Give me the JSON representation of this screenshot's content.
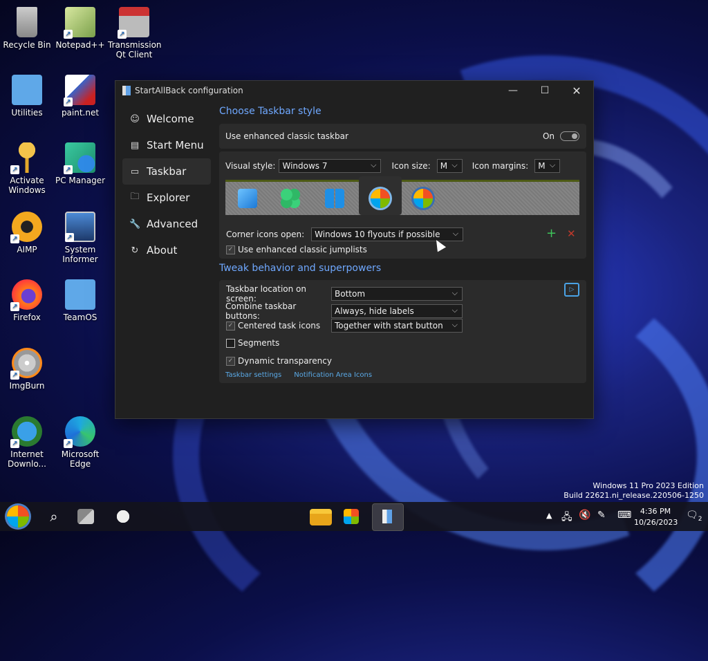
{
  "desktop_icons": [
    {
      "label": "Recycle Bin"
    },
    {
      "label": "Notepad++"
    },
    {
      "label": "Transmission Qt Client"
    },
    {
      "label": "Utilities"
    },
    {
      "label": "paint.net"
    },
    {
      "label": "Activate Windows"
    },
    {
      "label": "PC Manager"
    },
    {
      "label": "AIMP"
    },
    {
      "label": "System Informer"
    },
    {
      "label": "Firefox"
    },
    {
      "label": "TeamOS"
    },
    {
      "label": "ImgBurn"
    },
    {
      "label": "Internet Downlo..."
    },
    {
      "label": "Microsoft Edge"
    }
  ],
  "window": {
    "title": "StartAllBack configuration",
    "nav": [
      {
        "label": "Welcome",
        "icon": "smiley-icon"
      },
      {
        "label": "Start Menu",
        "icon": "start-menu-icon"
      },
      {
        "label": "Taskbar",
        "icon": "taskbar-icon"
      },
      {
        "label": "Explorer",
        "icon": "folder-icon"
      },
      {
        "label": "Advanced",
        "icon": "wrench-icon"
      },
      {
        "label": "About",
        "icon": "about-icon"
      }
    ],
    "taskbar_style": {
      "heading": "Choose Taskbar style",
      "enhanced_label": "Use enhanced classic taskbar",
      "enhanced_state": "On",
      "visual_style_label": "Visual style:",
      "visual_style_value": "Windows 7",
      "icon_size_label": "Icon size:",
      "icon_size_value": "M",
      "icon_margins_label": "Icon margins:",
      "icon_margins_value": "M",
      "corner_icons_label": "Corner icons open:",
      "corner_icons_value": "Windows 10 flyouts if possible",
      "jumplists_label": "Use enhanced classic jumplists"
    },
    "tweak": {
      "heading": "Tweak behavior and superpowers",
      "location_label": "Taskbar location on screen:",
      "location_value": "Bottom",
      "combine_label": "Combine taskbar buttons:",
      "combine_value": "Always, hide labels",
      "centered_label": "Centered task icons",
      "centered_value": "Together with start button",
      "segments_label": "Segments",
      "transparency_label": "Dynamic transparency",
      "link_taskbar_settings": "Taskbar settings",
      "link_notification_icons": "Notification Area Icons"
    }
  },
  "watermark": {
    "line1": "Windows 11 Pro 2023 Edition",
    "line2": "Build 22621.ni_release.220506-1250"
  },
  "clock": {
    "time": "4:36 PM",
    "date": "10/26/2023"
  },
  "notification_count": "2",
  "colors": {
    "accent_link": "#5aa9e6",
    "section_title": "#6fa8ff",
    "window_bg": "#202020",
    "panel_bg": "#2b2b2b"
  }
}
